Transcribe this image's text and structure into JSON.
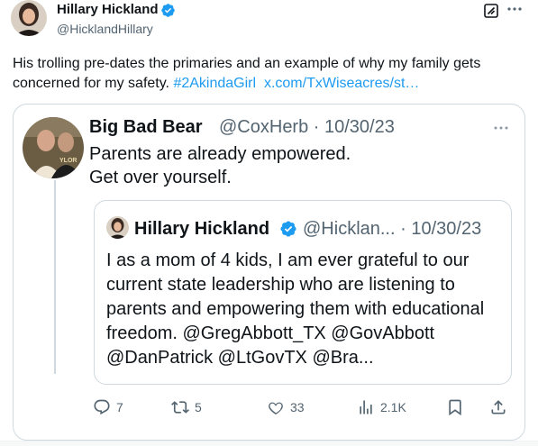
{
  "author": {
    "name": "Hillary Hickland",
    "handle": "@HicklandHillary"
  },
  "tweet": {
    "text_plain": "His trolling pre-dates the primaries and an example of why my family gets concerned for my safety. ",
    "hashtag": "#2AkindaGirl",
    "link": "x.com/TxWiseacres/st…"
  },
  "quoted": {
    "name": "Big Bad Bear",
    "handle": "@CoxHerb",
    "date": "10/30/23",
    "line1": "Parents are already empowered.",
    "line2": "Get over yourself."
  },
  "inner_quote": {
    "name": "Hillary Hickland",
    "handle": "@Hicklan...",
    "date": "10/30/23",
    "text": "I as a mom of 4 kids, I am ever grateful to our current state leadership who are listening to parents and empowering them with educational freedom. @GregAbbott_TX @GovAbbott @DanPatrick @LtGovTX @Bra..."
  },
  "actions": {
    "replies": "7",
    "retweets": "5",
    "likes": "33",
    "views": "2.1K"
  },
  "colors": {
    "link": "#1d9bf0",
    "verified": "#1d9bf0",
    "secondary_text": "#536471",
    "border": "#cfd9de"
  },
  "icons": [
    "verified-badge-icon",
    "grok-icon",
    "more-icon",
    "reply-icon",
    "retweet-icon",
    "like-icon",
    "views-icon",
    "bookmark-icon",
    "share-icon"
  ]
}
